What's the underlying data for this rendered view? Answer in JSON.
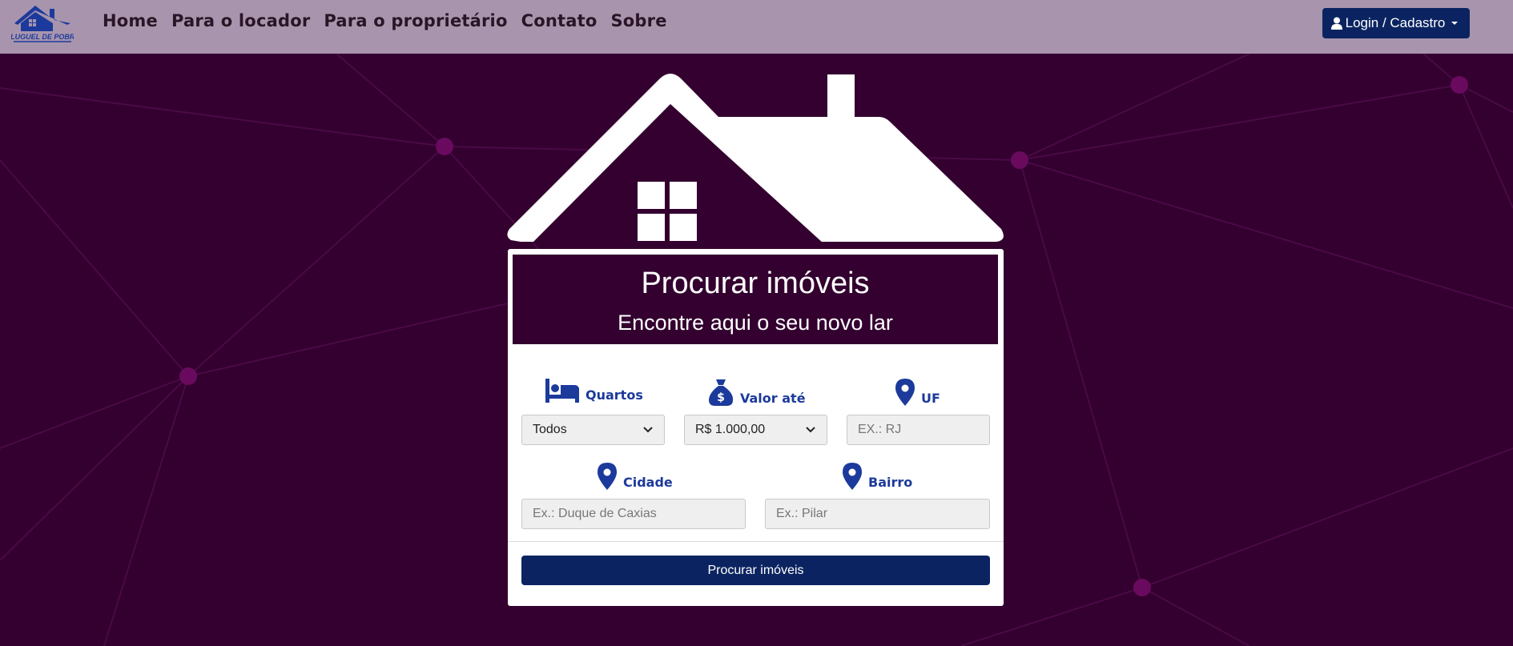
{
  "colors": {
    "background": "#33002f",
    "navbar": "#a895ad",
    "primary": "#0b2461",
    "label": "#1c3a9c",
    "node": "#6a0a5f"
  },
  "logo": {
    "text": "ALUGUEL DE POBRE"
  },
  "nav": {
    "links": [
      "Home",
      "Para o locador",
      "Para o proprietário",
      "Contato",
      "Sobre"
    ],
    "login_label": "Login / Cadastro"
  },
  "search": {
    "title": "Procurar imóveis",
    "subtitle": "Encontre aqui o seu novo lar",
    "quartos": {
      "label": "Quartos",
      "icon": "bed-icon",
      "value": "Todos"
    },
    "valor": {
      "label": "Valor até",
      "icon": "money-bag-icon",
      "value": "R$ 1.000,00"
    },
    "uf": {
      "label": "UF",
      "icon": "map-pin-icon",
      "placeholder": "EX.: RJ"
    },
    "cidade": {
      "label": "Cidade",
      "icon": "map-pin-icon",
      "placeholder": "Ex.: Duque de Caxias"
    },
    "bairro": {
      "label": "Bairro",
      "icon": "map-pin-icon",
      "placeholder": "Ex.: Pilar"
    },
    "submit_label": "Procurar imóveis"
  }
}
